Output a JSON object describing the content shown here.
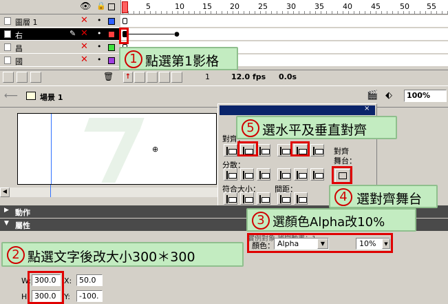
{
  "timeline": {
    "frame_numbers": [
      "1",
      "5",
      "10",
      "15",
      "20",
      "25",
      "30",
      "35",
      "40",
      "45",
      "50",
      "55"
    ],
    "layers": [
      {
        "name": "圖層 1",
        "color": "#3060ff",
        "selected": false
      },
      {
        "name": "右",
        "color": "#ff4040",
        "selected": true
      },
      {
        "name": "昌",
        "color": "#40e040",
        "selected": false
      },
      {
        "name": "國",
        "color": "#a040e0",
        "selected": false
      }
    ],
    "status": {
      "frame": "1",
      "fps": "12.0 fps",
      "time": "0.0s"
    }
  },
  "scene": {
    "name": "場景 1",
    "zoom": "100%"
  },
  "align_panel": {
    "title": "對齊",
    "align_label": "對齊：",
    "distribute_label": "分散：",
    "match_size_label": "符合大小：",
    "spacing_label": "間距：",
    "to_stage_label": "對齊\n舞台："
  },
  "panels": {
    "actions": "動作",
    "properties": "屬性"
  },
  "properties": {
    "truncated_text": "實例對象  補間動畫：1",
    "color_label": "顏色：",
    "color_value": "Alpha",
    "alpha_value": "10%",
    "w_label": "W:",
    "w_value": "300.0",
    "h_label": "H:",
    "h_value": "300.0",
    "x_label": "X:",
    "x_value": "50.0",
    "y_label": "Y:",
    "y_value": "-100."
  },
  "callouts": [
    {
      "num": "1",
      "text": "點選第1影格"
    },
    {
      "num": "2",
      "text": "點選文字後改大小300＊300"
    },
    {
      "num": "3",
      "text": "選顏色Alpha改10%"
    },
    {
      "num": "4",
      "text": "選對齊舞台"
    },
    {
      "num": "5",
      "text": "選水平及垂直對齊"
    }
  ],
  "colors": {
    "highlight_red": "#e00000",
    "callout_bg": "#c3ecc1",
    "selected_row": "#000000"
  }
}
